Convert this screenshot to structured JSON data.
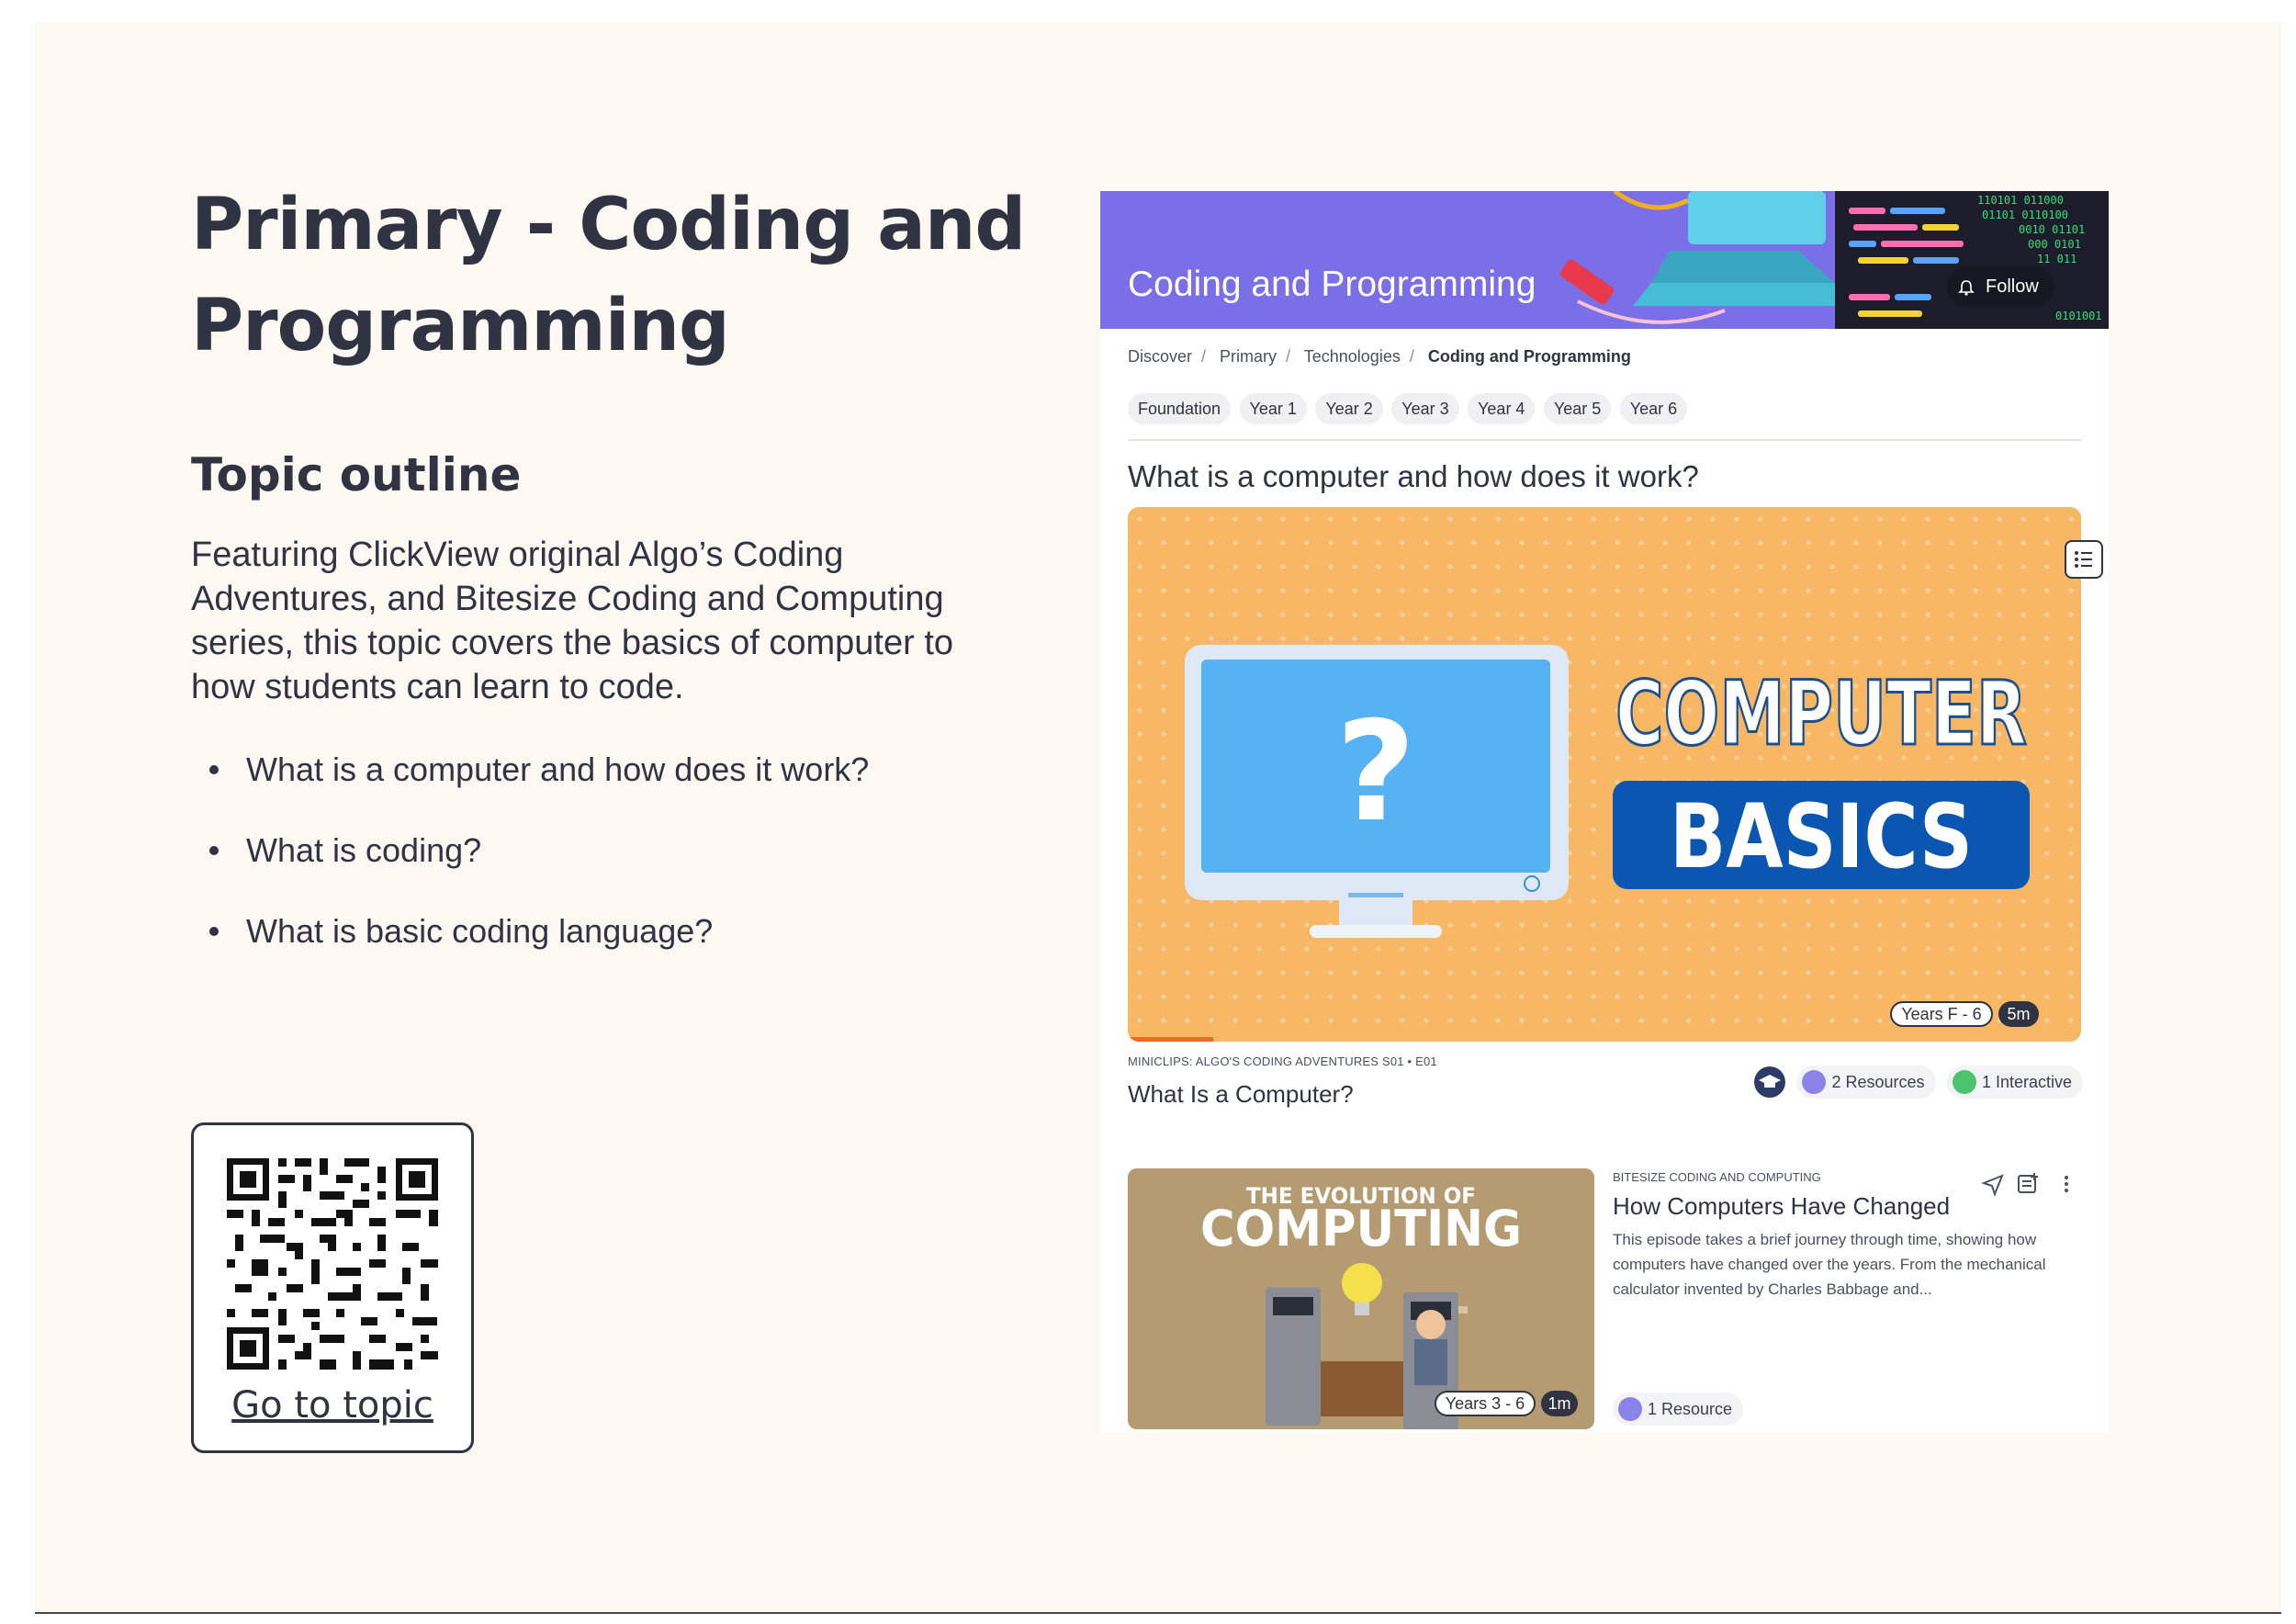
{
  "page": {
    "title": "Primary - Coding and Programming",
    "outline_heading": "Topic outline",
    "description": "Featuring ClickView original Algo’s Coding Adventures, and Bitesize Coding and Computing series, this topic covers the basics of computer to how students can learn to code.",
    "bullets": [
      "What is a computer and how does it work?",
      "What is coding?",
      "What is basic coding language?"
    ],
    "qr": {
      "link_label": "Go to topic",
      "icon": "qr-code-icon"
    }
  },
  "screenshot": {
    "banner": {
      "title": "Coding and Programming",
      "follow_label": "Follow",
      "color": "#7a6fe6"
    },
    "breadcrumb": [
      "Discover",
      "Primary",
      "Technologies",
      "Coding and Programming"
    ],
    "year_tabs": [
      "Foundation",
      "Year 1",
      "Year 2",
      "Year 3",
      "Year 4",
      "Year 5",
      "Year 6"
    ],
    "section_title": "What is a computer and how does it work?",
    "hero": {
      "image_text_line1": "COMPUTER",
      "image_text_line2": "BASICS",
      "years_badge": "Years F - 6",
      "duration": "5m",
      "progress": 0.09,
      "series": "MINICLIPS: ALGO'S CODING ADVENTURES S01 • E01",
      "title": "What Is a Computer?",
      "resources": "2 Resources",
      "interactive": "1 Interactive"
    },
    "card": {
      "image_text_line1": "THE EVOLUTION OF",
      "image_text_line2": "COMPUTING",
      "years_badge": "Years 3 - 6",
      "duration": "1m",
      "series": "BITESIZE CODING AND COMPUTING",
      "title": "How Computers Have Changed",
      "description": "This episode takes a brief journey through time, showing how computers have changed over the years. From the mechanical calculator invented by Charles Babbage and...",
      "resources": "1 Resource"
    }
  }
}
